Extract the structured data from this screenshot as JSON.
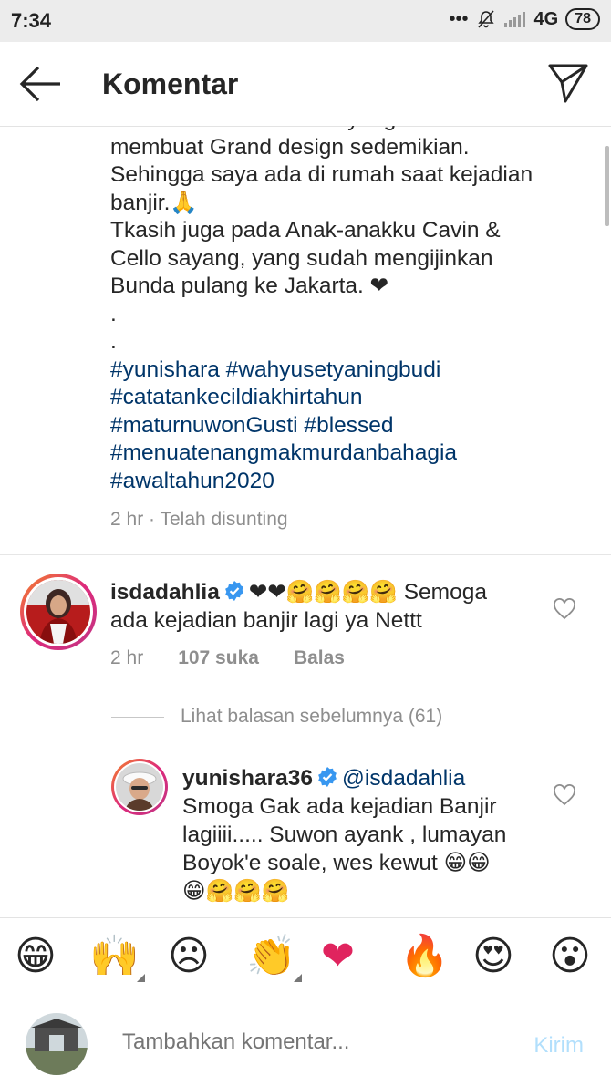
{
  "status_bar": {
    "time": "7:34",
    "dots": "•••",
    "network": "4G",
    "battery": "78"
  },
  "header": {
    "title": "Komentar"
  },
  "caption": {
    "lines": [
      "Maturnuwon GustiAllah yang sudah",
      "membuat Grand design sedemikian.",
      "Sehingga saya ada di rumah saat kejadian",
      "banjir.🙏",
      "Tkasih juga pada Anak-anakku Cavin &",
      "Cello sayang, yang sudah mengijinkan",
      "Bunda pulang ke Jakarta. ❤",
      ".",
      "."
    ],
    "hashtags": [
      "#yunishara #wahyusetyaningbudi",
      "#catatankecildiakhirtahun",
      "#maturnuwonGusti #blessed",
      "#menuatenangmakmurdanbahagia",
      "#awaltahun2020"
    ],
    "meta": "2 hr · Telah disunting"
  },
  "comments": [
    {
      "username": "isdadahlia",
      "text_line1": "❤❤🤗🤗🤗🤗 Semoga",
      "text_line2": "ada kejadian banjir lagi ya Nettt",
      "time": "2 hr",
      "likes": "107 suka",
      "reply": "Balas"
    }
  ],
  "view_replies": "Lihat balasan sebelumnya (61)",
  "reply": {
    "username": "yunishara36",
    "mention": "@isdadahlia",
    "lines": [
      "Smoga Gak ada kejadian Banjir",
      "lagiiii..... Suwon ayank , lumayan",
      "Boyok'e soale, wes kewut 😁😁",
      "😁🤗🤗🤗"
    ]
  },
  "emoji_bar": {
    "items": [
      {
        "name": "grinning-emoji",
        "glyph": "😁"
      },
      {
        "name": "raising-hands-emoji",
        "glyph": "🙌"
      },
      {
        "name": "frowning-emoji",
        "glyph": "☹"
      },
      {
        "name": "clapping-emoji",
        "glyph": "👏"
      },
      {
        "name": "heart-emoji",
        "glyph": "❤"
      },
      {
        "name": "fire-emoji",
        "glyph": "🔥"
      },
      {
        "name": "heart-eyes-emoji",
        "glyph": "😍"
      },
      {
        "name": "surprised-emoji",
        "glyph": "😮"
      }
    ]
  },
  "comment_input": {
    "placeholder": "Tambahkan komentar...",
    "send": "Kirim"
  },
  "colors": {
    "link": "#003569",
    "muted": "#8e8e8e",
    "verified": "#3897f0",
    "send_disabled": "#b2dffc"
  }
}
